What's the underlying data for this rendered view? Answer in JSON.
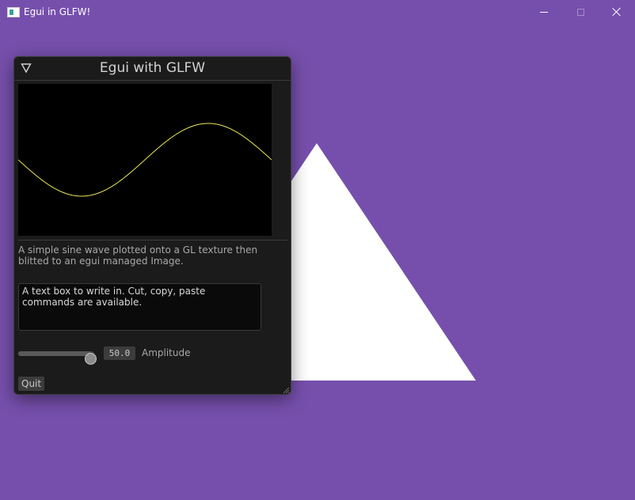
{
  "os_window": {
    "title": "Egui in GLFW!",
    "icon": "app-icon",
    "controls": [
      "minimize-icon",
      "maximize-icon",
      "close-icon"
    ]
  },
  "colors": {
    "background": "#764fac",
    "triangle": "#ffffff",
    "panel": "#1b1b1b",
    "plot_background": "#000000",
    "sine_stroke": "#e8e85a"
  },
  "egui_window": {
    "title": "Egui with GLFW",
    "collapse_icon": "collapse-triangle-icon",
    "plot": {
      "wave": "sine",
      "cycles": 1,
      "phase": 3.1416
    },
    "description": "A simple sine wave plotted onto a GL texture then blitted to an egui managed Image.",
    "text_box_value": "A text box to write in. Cut, copy, paste commands are available.",
    "slider": {
      "value": "50.0",
      "fraction": 1.0,
      "label": "Amplitude"
    },
    "quit_label": "Quit"
  }
}
